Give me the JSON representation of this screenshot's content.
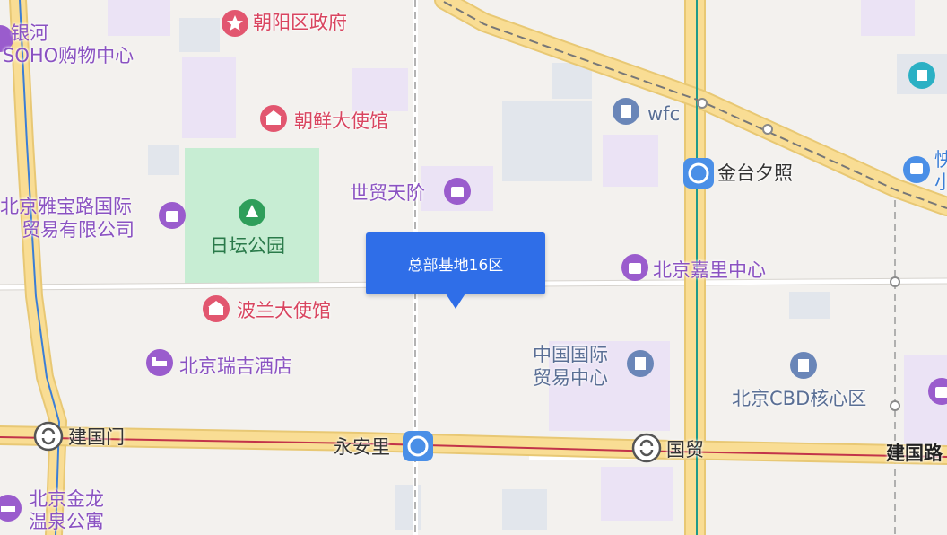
{
  "marker": {
    "label": "总部基地16区"
  },
  "labels": {
    "chaoyang_gov": "朝阳区政府",
    "yinhe_1": "银河",
    "yinhe_2": "SOHO购物中心",
    "korea_embassy": "朝鲜大使馆",
    "wfc": "wfc",
    "jintai": "金台夕照",
    "sanlitun_partial": "怏",
    "sanlitun_partial2": "小",
    "shimao": "世贸天阶",
    "yabao_1": "北京雅宝路国际",
    "yabao_2": "贸易有限公司",
    "ritan": "日坛公园",
    "kerry": "北京嘉里中心",
    "poland_embassy": "波兰大使馆",
    "ruiji": "北京瑞吉酒店",
    "cwtc_1": "中国国际",
    "cwtc_2": "贸易中心",
    "cbd": "北京CBD核心区",
    "jianguomen": "建国门",
    "yonganli": "永安里",
    "guomao": "国贸",
    "jianguolu": "建国路",
    "jinlong_1": "北京金龙",
    "jinlong_2": "温泉公寓"
  },
  "colors": {
    "poi_purple": "#8a52c2",
    "poi_red": "#d94560",
    "park": "#c7edd3",
    "marker": "#2f6ee8",
    "subway_icon": "#4a8fe7",
    "arterial": "#f7d98c"
  }
}
